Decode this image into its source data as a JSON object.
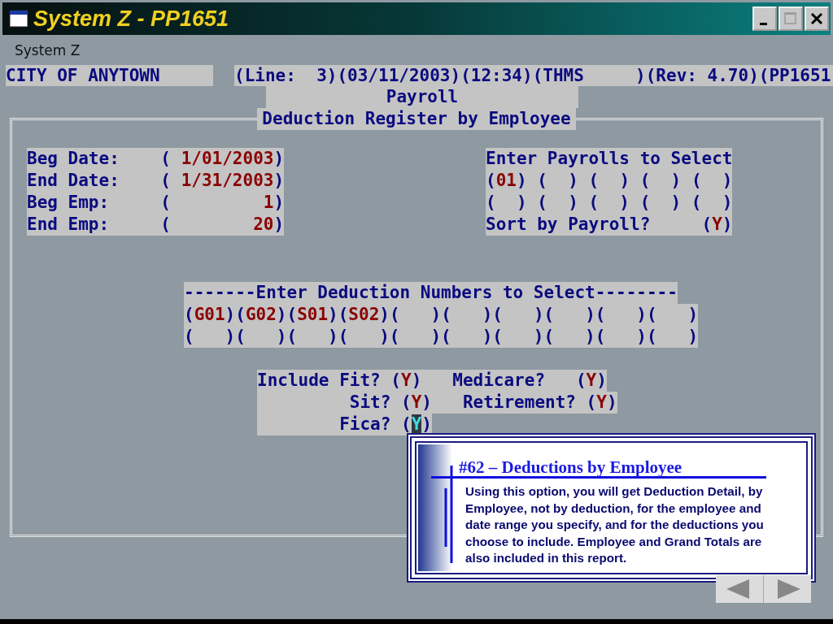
{
  "window": {
    "title": "System Z - PP1651"
  },
  "menu": [
    {
      "label": "System Z"
    }
  ],
  "header": {
    "company": "CITY OF ANYTOWN",
    "status": "(Line:  3)(03/11/2003)(12:34)(THMS     )(Rev: 4.70)(PP1651"
  },
  "subtitle": "Payroll",
  "form": {
    "title": "Deduction Register by Employee",
    "blocks": [
      {
        "kind": "dates",
        "lines": [
          [
            {
              "kind": "label",
              "text": "Beg Date:    ("
            },
            {
              "kind": "value",
              "text": " 1/01/2003"
            },
            {
              "kind": "label",
              "text": ")"
            }
          ],
          [
            {
              "kind": "label",
              "text": "End Date:    ("
            },
            {
              "kind": "value",
              "text": " 1/31/2003"
            },
            {
              "kind": "label",
              "text": ")"
            }
          ],
          [
            {
              "kind": "label",
              "text": "Beg Emp:     ("
            },
            {
              "kind": "value",
              "text": "         1"
            },
            {
              "kind": "label",
              "text": ")"
            }
          ],
          [
            {
              "kind": "label",
              "text": "End Emp:     ("
            },
            {
              "kind": "value",
              "text": "        20"
            },
            {
              "kind": "label",
              "text": ")"
            }
          ]
        ]
      },
      {
        "kind": "payrolls",
        "lines": [
          [
            {
              "kind": "label",
              "text": "Enter Payrolls to Select"
            }
          ],
          [
            {
              "kind": "label",
              "text": "("
            },
            {
              "kind": "value",
              "text": "01"
            },
            {
              "kind": "label",
              "text": ") (  ) (  ) (  ) (  )"
            }
          ],
          [
            {
              "kind": "label",
              "text": "(  ) (  ) (  ) (  ) (  )"
            }
          ],
          [
            {
              "kind": "label",
              "text": "Sort by Payroll?     ("
            },
            {
              "kind": "value",
              "text": "Y"
            },
            {
              "kind": "label",
              "text": ")"
            }
          ]
        ]
      },
      {
        "kind": "deductions",
        "lines": [
          [
            {
              "kind": "label",
              "text": "-------Enter Deduction Numbers to Select--------"
            }
          ],
          [
            {
              "kind": "label",
              "text": "("
            },
            {
              "kind": "value",
              "text": "G01"
            },
            {
              "kind": "label",
              "text": ")("
            },
            {
              "kind": "value",
              "text": "G02"
            },
            {
              "kind": "label",
              "text": ")("
            },
            {
              "kind": "value",
              "text": "S01"
            },
            {
              "kind": "label",
              "text": ")("
            },
            {
              "kind": "value",
              "text": "S02"
            },
            {
              "kind": "label",
              "text": ")(   )(   )(   )(   )(   )(   )"
            }
          ],
          [
            {
              "kind": "label",
              "text": "(   )(   )(   )(   )(   )(   )(   )(   )(   )(   )"
            }
          ]
        ]
      },
      {
        "kind": "taxes",
        "lines": [
          [
            {
              "kind": "label",
              "text": "Include Fit? ("
            },
            {
              "kind": "value",
              "text": "Y"
            },
            {
              "kind": "label",
              "text": ")   Medicare?   ("
            },
            {
              "kind": "value",
              "text": "Y"
            },
            {
              "kind": "label",
              "text": ")"
            }
          ],
          [
            {
              "kind": "label",
              "text": "         Sit? ("
            },
            {
              "kind": "value",
              "text": "Y"
            },
            {
              "kind": "label",
              "text": ")   Retirement? ("
            },
            {
              "kind": "value",
              "text": "Y"
            },
            {
              "kind": "label",
              "text": ")"
            }
          ],
          [
            {
              "kind": "label",
              "text": "        Fica? ("
            },
            {
              "kind": "cursor",
              "text": "Y"
            },
            {
              "kind": "label",
              "text": ")"
            }
          ]
        ]
      }
    ]
  },
  "callout": {
    "title": "#62 – Deductions by Employee",
    "body": "Using this option, you will get Deduction Detail, by Employee, not by deduction, for the employee and date range you specify, and for the deductions you choose to include.  Employee and Grand Totals are also included in this report."
  }
}
